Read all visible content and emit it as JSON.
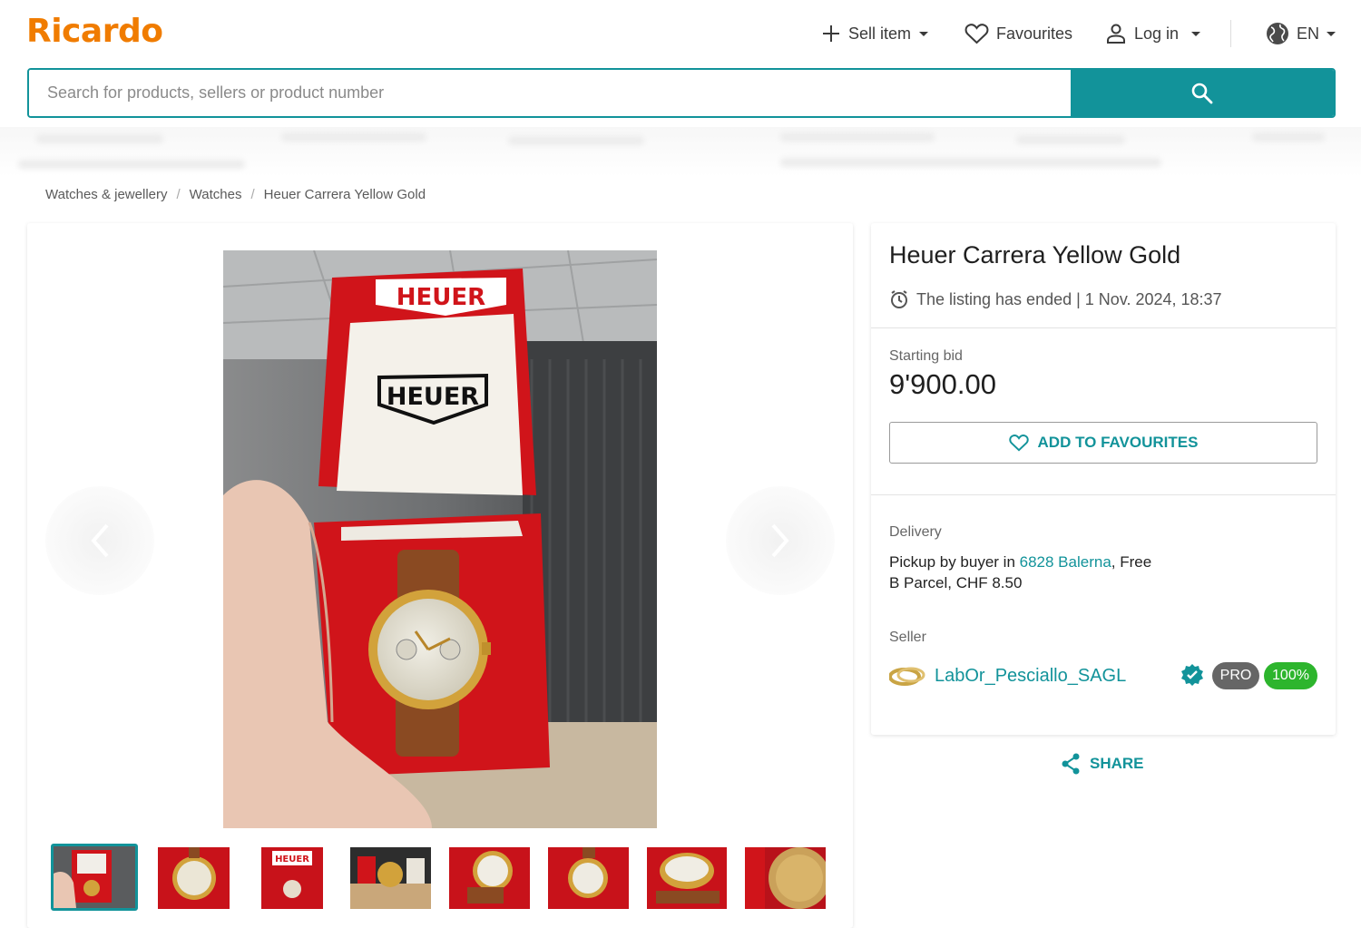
{
  "header": {
    "logo": "Ricardo",
    "sell_label": "Sell item",
    "favourites_label": "Favourites",
    "login_label": "Log in",
    "lang_label": "EN"
  },
  "search": {
    "placeholder": "Search for products, sellers or product number",
    "value": ""
  },
  "breadcrumb": [
    "Watches & jewellery",
    "Watches",
    "Heuer Carrera Yellow Gold"
  ],
  "gallery": {
    "main_image_brand_text": "HEUER",
    "thumbnail_count": 8,
    "selected_thumbnail": 1
  },
  "listing": {
    "title": "Heuer Carrera Yellow Gold",
    "status": "The listing has ended | 1 Nov. 2024, 18:37",
    "starting_bid_label": "Starting bid",
    "starting_bid": "9'900.00",
    "add_fav_label": "ADD TO FAVOURITES",
    "delivery_label": "Delivery",
    "delivery_pickup_prefix": "Pickup by buyer in ",
    "delivery_pickup_location": "6828 Balerna",
    "delivery_pickup_suffix": ", Free",
    "delivery_parcel": "B Parcel, CHF 8.50",
    "seller_label": "Seller",
    "seller_name": "LabOr_Pesciallo_SAGL",
    "seller_pro": "PRO",
    "seller_rating": "100%",
    "share_label": "SHARE"
  },
  "colors": {
    "accent": "#12939a",
    "brand": "#f07c00",
    "rating": "#2db52d"
  }
}
